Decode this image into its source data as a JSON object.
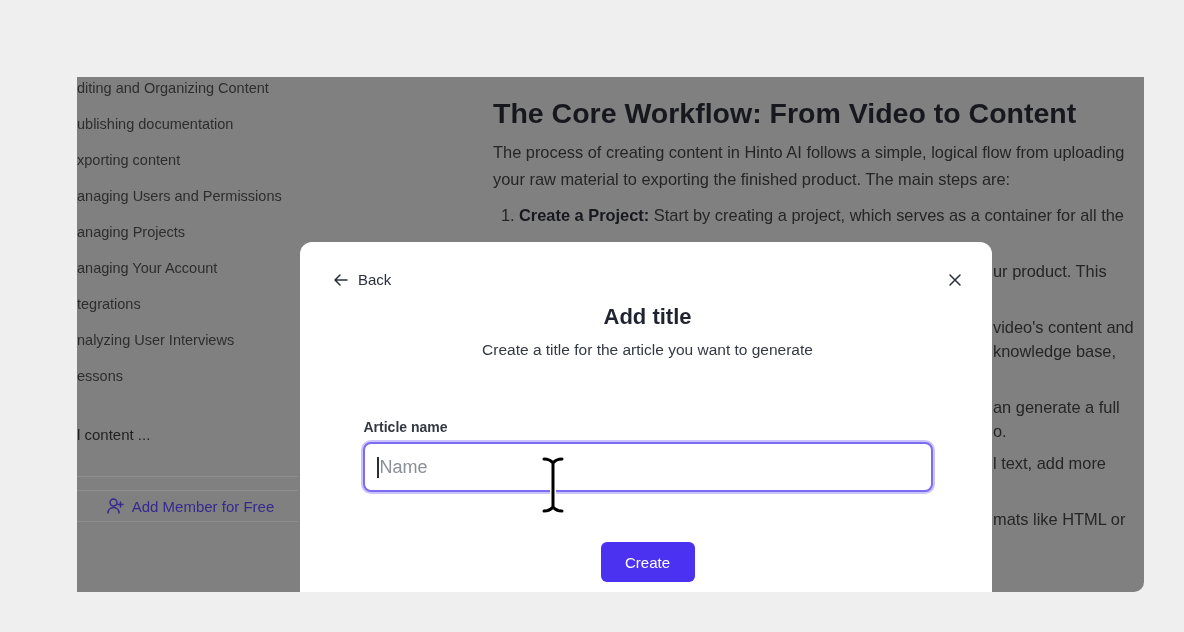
{
  "sidebar": {
    "items": [
      {
        "label": "diting and Organizing Content"
      },
      {
        "label": "ublishing documentation"
      },
      {
        "label": "xporting content"
      },
      {
        "label": "anaging Users and Permissions"
      },
      {
        "label": "anaging Projects"
      },
      {
        "label": "anaging Your Account"
      },
      {
        "label": "tegrations"
      },
      {
        "label": "nalyzing User Interviews"
      },
      {
        "label": "essons"
      }
    ],
    "more_link": "l content ...",
    "add_member_button": "Add Member for Free"
  },
  "article": {
    "heading": "The Core Workflow: From Video to Content",
    "intro": "The process of creating content in Hinto AI follows a simple, logical flow from uploading your raw material to exporting the finished product. The main steps are:",
    "steps": [
      {
        "number": "1.",
        "text": "**Create a Project:** Start by creating a project, which serves as a container for all the"
      }
    ],
    "visible_fragments": [
      {
        "lines": [
          "ur product. This"
        ]
      },
      {
        "lines": [
          "video's content and",
          "knowledge base,"
        ]
      },
      {
        "lines": [
          "an generate a full",
          "o."
        ]
      },
      {
        "lines": [
          "l text, add more"
        ]
      },
      {
        "lines": [
          "mats like HTML or"
        ]
      }
    ]
  },
  "dialog": {
    "back_label": "Back",
    "title": "Add title",
    "subtitle": "Create a title for the article you want to generate",
    "field": {
      "label": "Article name",
      "placeholder": "Name",
      "focused": true
    },
    "submit_button": "Create"
  }
}
